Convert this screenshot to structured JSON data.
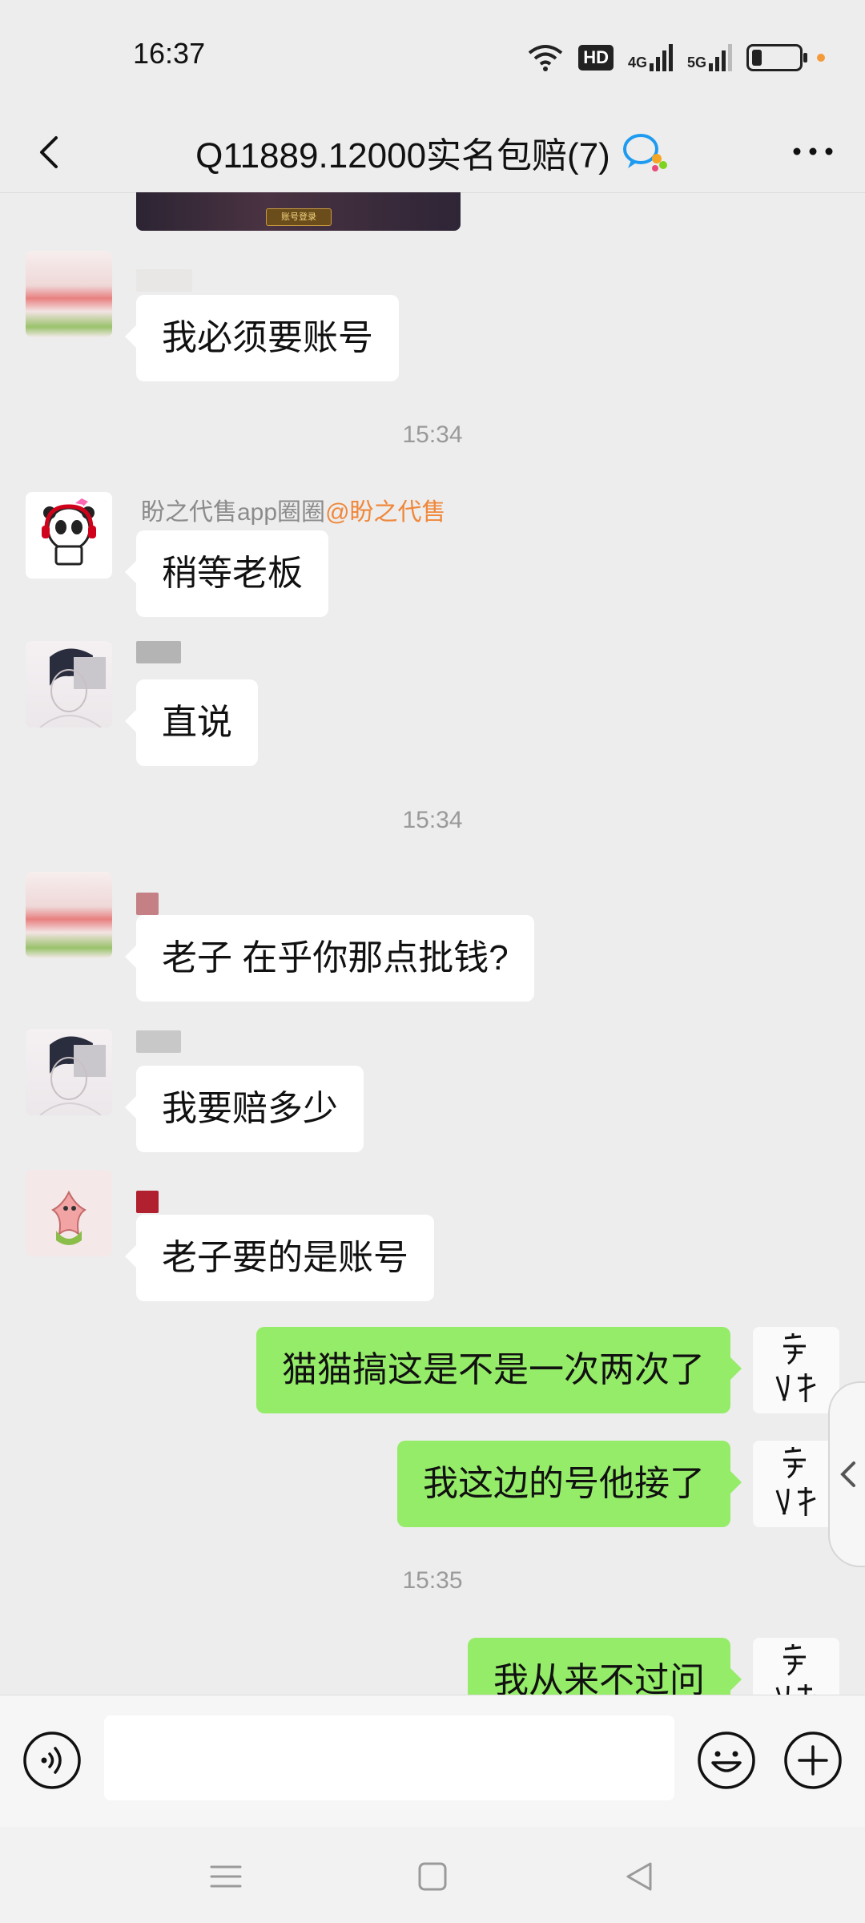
{
  "status_bar": {
    "time": "16:37",
    "hd_label": "HD",
    "net1": "4G",
    "net2": "5G"
  },
  "header": {
    "title": "Q11889.12000实名包赔(7)",
    "back_icon": "chevron-left-icon",
    "more_icon": "ellipsis-icon"
  },
  "chat": {
    "image_preview_button": "账号登录",
    "messages": [
      {
        "type": "in",
        "avatar": "blurred-avatar",
        "text": "我必须要账号"
      },
      {
        "type": "time",
        "text": "15:34"
      },
      {
        "type": "in",
        "avatar": "panda-avatar",
        "sender": "盼之代售app圈圈",
        "mention": "@盼之代售",
        "text": "稍等老板"
      },
      {
        "type": "in",
        "avatar": "anime-boy-avatar",
        "text": "直说"
      },
      {
        "type": "time",
        "text": "15:34"
      },
      {
        "type": "in",
        "avatar": "blurred-avatar",
        "text": "老子 在乎你那点批钱?"
      },
      {
        "type": "in",
        "avatar": "anime-boy-avatar",
        "text": "我要赔多少"
      },
      {
        "type": "in",
        "avatar": "starfish-avatar",
        "text": "老子要的是账号"
      },
      {
        "type": "out",
        "avatar": "calligraphy-avatar",
        "text": "猫猫搞这是不是一次两次了"
      },
      {
        "type": "out",
        "avatar": "calligraphy-avatar",
        "text": "我这边的号他接了"
      },
      {
        "type": "time",
        "text": "15:35"
      },
      {
        "type": "out",
        "avatar": "calligraphy-avatar",
        "text": "我从来不过问"
      }
    ]
  },
  "input_bar": {
    "placeholder": "",
    "voice_icon": "voice-icon",
    "emoji_icon": "emoji-icon",
    "plus_icon": "plus-icon"
  },
  "colors": {
    "background": "#ededed",
    "outgoing_bubble": "#95ec69",
    "incoming_bubble": "#ffffff",
    "mention": "#f0873a"
  }
}
